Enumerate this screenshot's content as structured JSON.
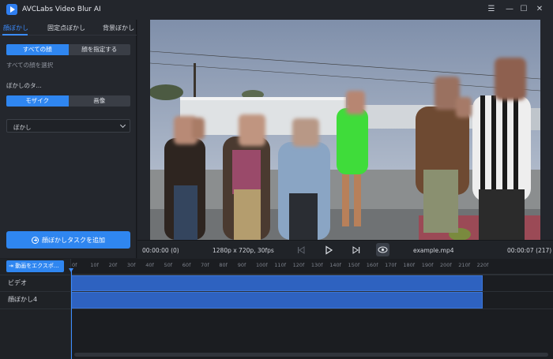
{
  "app": {
    "title": "AVCLabs Video Blur AI"
  },
  "window_controls": {
    "menu": "☰",
    "minimize": "—",
    "maximize": "☐",
    "close": "✕"
  },
  "tabs": [
    {
      "label": "顔ぼかし",
      "active": true
    },
    {
      "label": "固定点ぼかし",
      "active": false
    },
    {
      "label": "背景ぼかし",
      "active": false
    }
  ],
  "face_mode": {
    "options": [
      "すべての顔",
      "顔を指定する"
    ],
    "selected": "すべての顔"
  },
  "face_hint": "すべての顔を選択",
  "blur_type": {
    "label": "ぼかしのタ...",
    "options": [
      "モザイク",
      "画像"
    ],
    "selected": "モザイク"
  },
  "blur_select": {
    "value": "ぼかし"
  },
  "add_task_label": "顔ぼかしタスクを追加",
  "player": {
    "current_time": "00:00:00 (0)",
    "resolution": "1280p x 720p, 30fps",
    "filename": "example.mp4",
    "duration": "00:00:07 (217)"
  },
  "timeline": {
    "export_label": "動画をエクスポ...",
    "ticks": [
      "0f",
      "10f",
      "20f",
      "30f",
      "40f",
      "50f",
      "60f",
      "70f",
      "80f",
      "90f",
      "100f",
      "110f",
      "120f",
      "130f",
      "140f",
      "150f",
      "160f",
      "170f",
      "180f",
      "190f",
      "200f",
      "210f",
      "220f"
    ],
    "tracks": [
      {
        "label": "ビデオ"
      },
      {
        "label": "顔ぼかし4"
      }
    ]
  },
  "colors": {
    "accent": "#2f86f0",
    "background": "#1d1f24",
    "panel": "#24272d",
    "clip": "#2e62c0"
  },
  "icons": [
    "app-logo-icon",
    "menu-icon",
    "minimize-icon",
    "maximize-icon",
    "close-icon",
    "chevron-down-icon",
    "plus-circle-icon",
    "skip-back-icon",
    "play-icon",
    "skip-forward-icon",
    "eye-icon",
    "export-icon"
  ]
}
